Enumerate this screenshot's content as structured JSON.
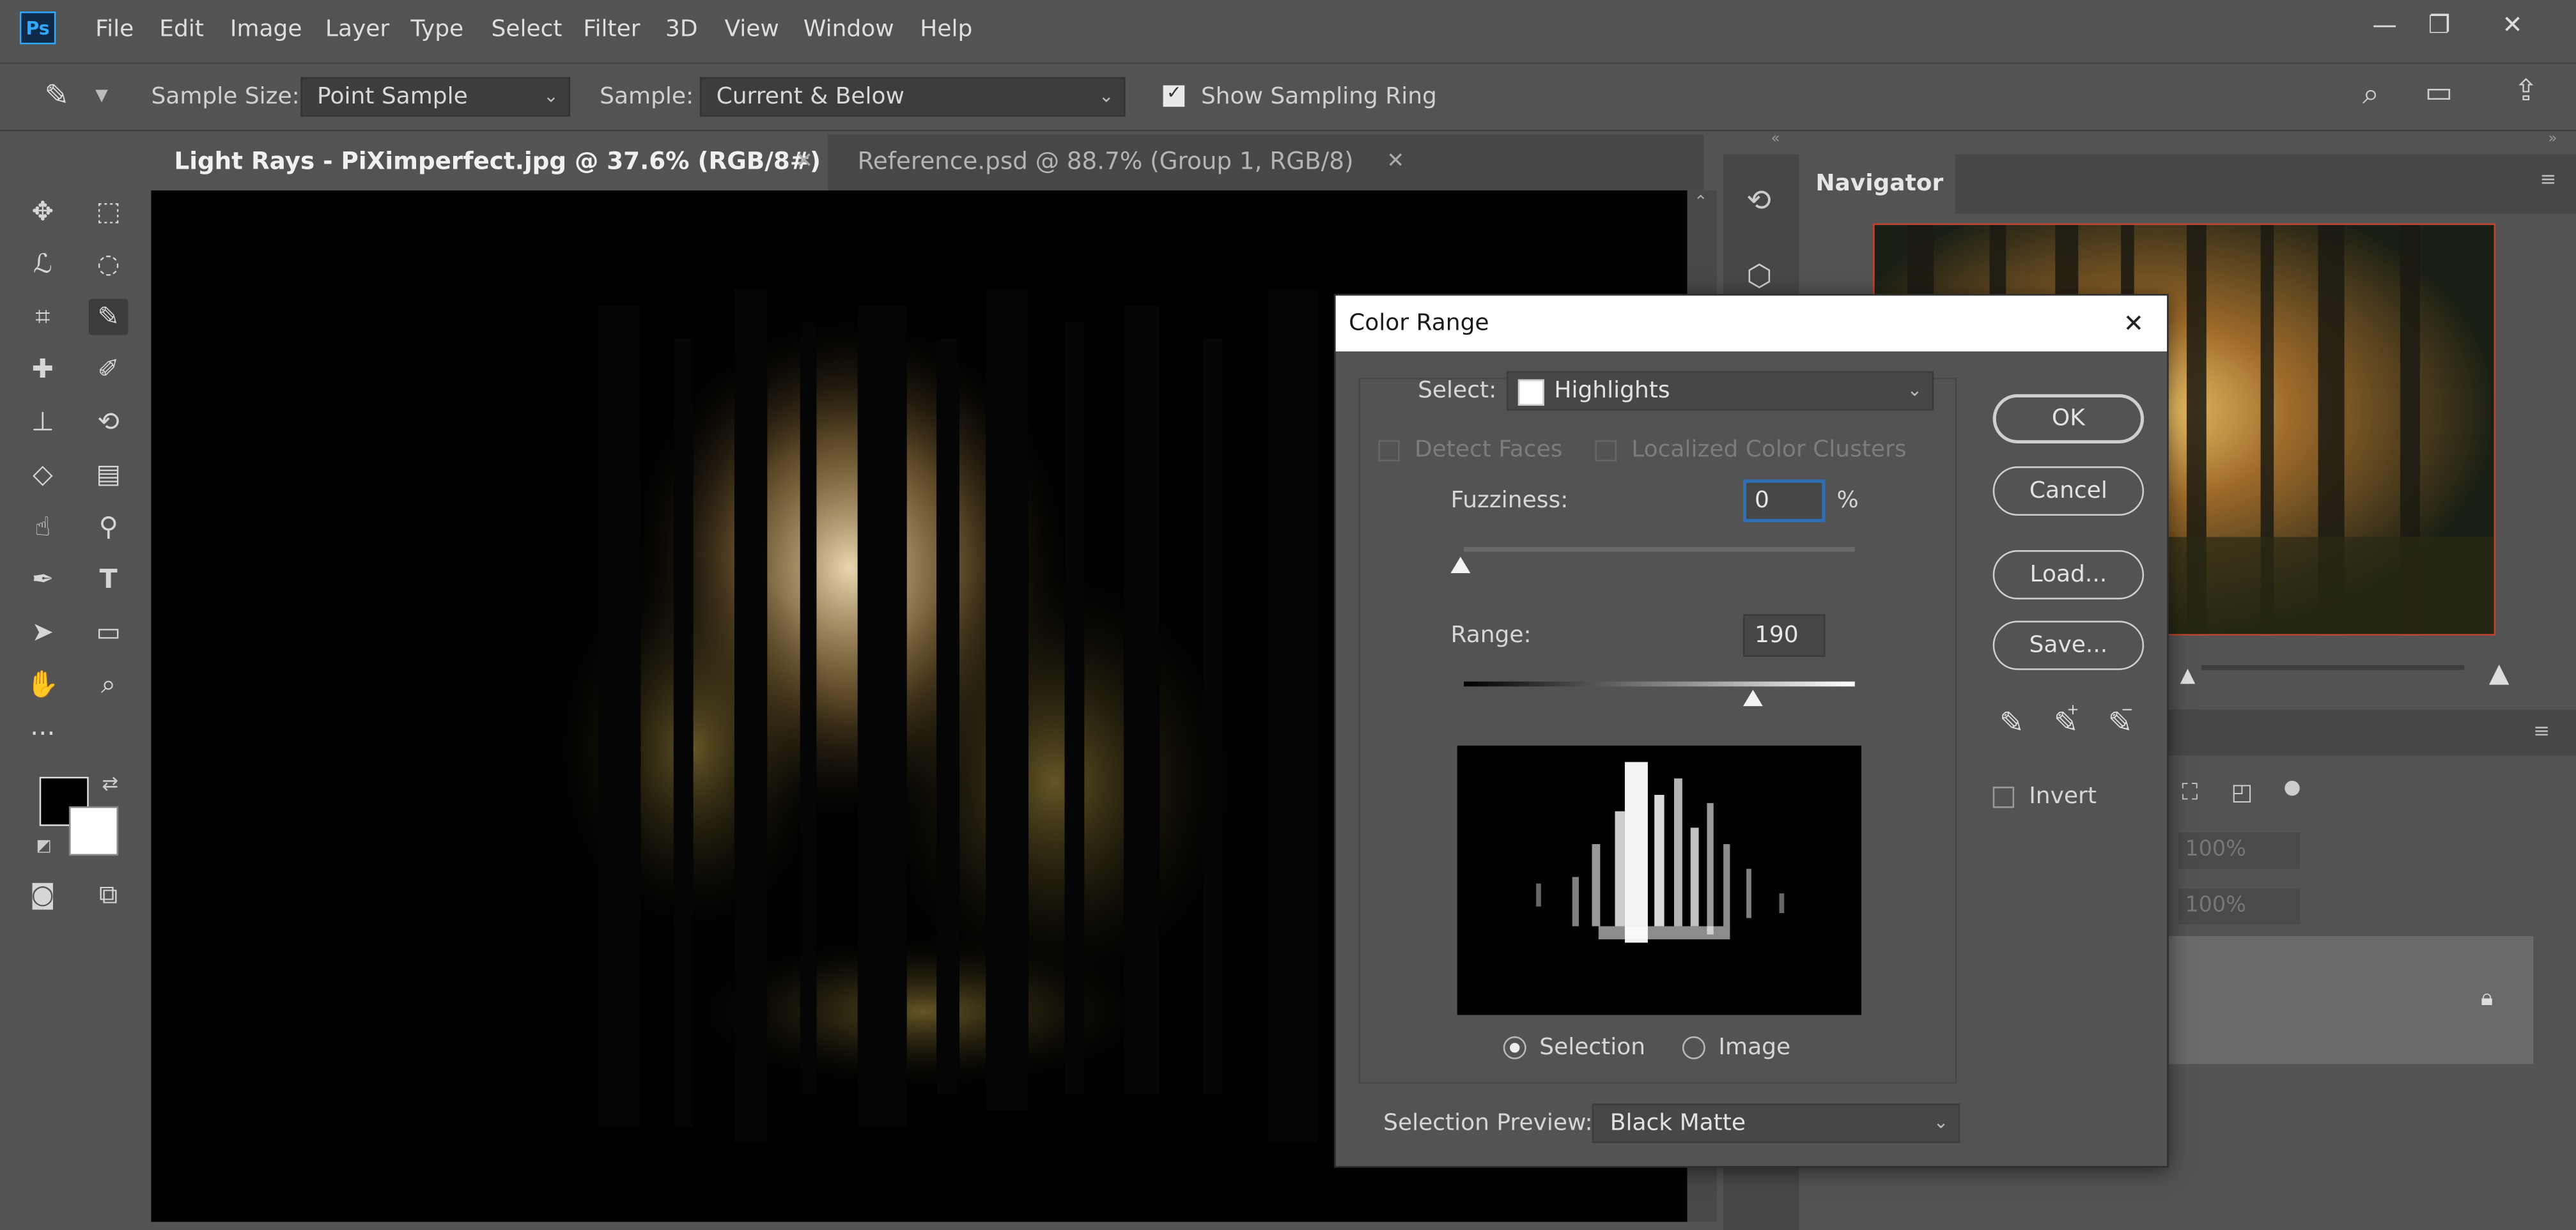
{
  "menu": {
    "logo": "Ps",
    "items": [
      "File",
      "Edit",
      "Image",
      "Layer",
      "Type",
      "Select",
      "Filter",
      "3D",
      "View",
      "Window",
      "Help"
    ]
  },
  "window_controls": {
    "minimize": "—",
    "restore": "❐",
    "close": "✕"
  },
  "options_bar": {
    "sample_size_label": "Sample Size:",
    "sample_size_value": "Point Sample",
    "sample_label": "Sample:",
    "sample_value": "Current & Below",
    "show_ring_label": "Show Sampling Ring",
    "show_ring_checked": true
  },
  "tabs": [
    {
      "label": "Light Rays - PiXimperfect.jpg @ 37.6% (RGB/8#)",
      "active": true
    },
    {
      "label": "Reference.psd @ 88.7% (Group 1, RGB/8)",
      "active": false
    }
  ],
  "panels": {
    "navigator_title": "Navigator",
    "opacity_value": "100%",
    "fill_value": "100%"
  },
  "dialog": {
    "title": "Color Range",
    "select_label": "Select:",
    "select_value": "Highlights",
    "detect_faces_label": "Detect Faces",
    "localized_clusters_label": "Localized Color Clusters",
    "fuzziness_label": "Fuzziness:",
    "fuzziness_value": "0",
    "fuzziness_unit": "%",
    "range_label": "Range:",
    "range_value": "190",
    "buttons": {
      "ok": "OK",
      "cancel": "Cancel",
      "load": "Load...",
      "save": "Save..."
    },
    "invert_label": "Invert",
    "invert_checked": false,
    "radio_selection_label": "Selection",
    "radio_image_label": "Image",
    "selected_radio": "selection",
    "selection_preview_label": "Selection Preview:",
    "selection_preview_value": "Black Matte"
  },
  "colors": {
    "ui_bg": "#535353",
    "canvas_bg": "#000000",
    "focus_blue": "#2e6fb6",
    "highlight_warm": "#f3dcb4"
  }
}
